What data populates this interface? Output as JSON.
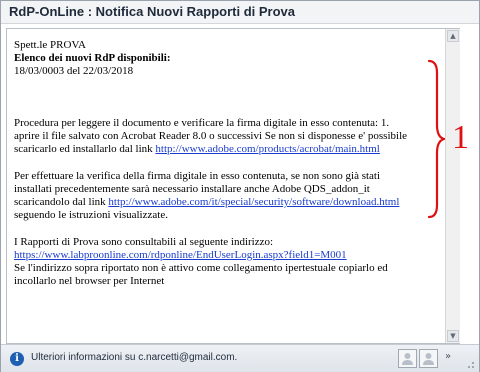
{
  "window": {
    "title": "RdP-OnLine : Notifica Nuovi Rapporti di Prova"
  },
  "message": {
    "greeting": "Spett.le PROVA",
    "heading": "Elenco dei nuovi RdP disponibili:",
    "entry": "18/03/0003 del 22/03/2018",
    "procedure": {
      "line1": "Procedura per leggere il documento e verificare la firma digitale in esso contenuta: 1.",
      "line2": "aprire il file salvato con Acrobat Reader 8.0 o successivi Se non si disponesse e' possibile",
      "line3_prefix": "scaricarlo ed installarlo dal link ",
      "link": "http://www.adobe.com/products/acrobat/main.html"
    },
    "signature_check": {
      "line1": "Per effettuare la verifica della firma digitale in esso contenuta, se non sono già stati",
      "line2": "installati precedentemente sarà necessario installare anche Adobe QDS_addon_it",
      "line3_prefix": "scaricandolo dal link ",
      "link": "http://www.adobe.com/it/special/security/software/download.html",
      "line4": "seguendo le istruzioni visualizzate."
    },
    "access": {
      "line1": "I Rapporti di Prova sono consultabili al seguente indirizzo:",
      "link": "https://www.labproonline.com/rdponline/EndUserLogin.aspx?field1=M001",
      "line2": "Se l'indirizzo sopra riportato non è attivo come collegamento ipertestuale copiarlo ed",
      "line3": "incollarlo nel browser per Internet"
    }
  },
  "annotation": {
    "label": "1",
    "color": "#e01010"
  },
  "statusbar": {
    "info_text": "Ulteriori informazioni su c.narcetti@gmail.com."
  },
  "icons": {
    "info": "info-icon",
    "scroll_up": "arrow-up-icon",
    "scroll_down": "arrow-down-icon",
    "contact1": "person-icon",
    "contact2": "person-icon",
    "overflow": "chevron-double-right-icon"
  }
}
